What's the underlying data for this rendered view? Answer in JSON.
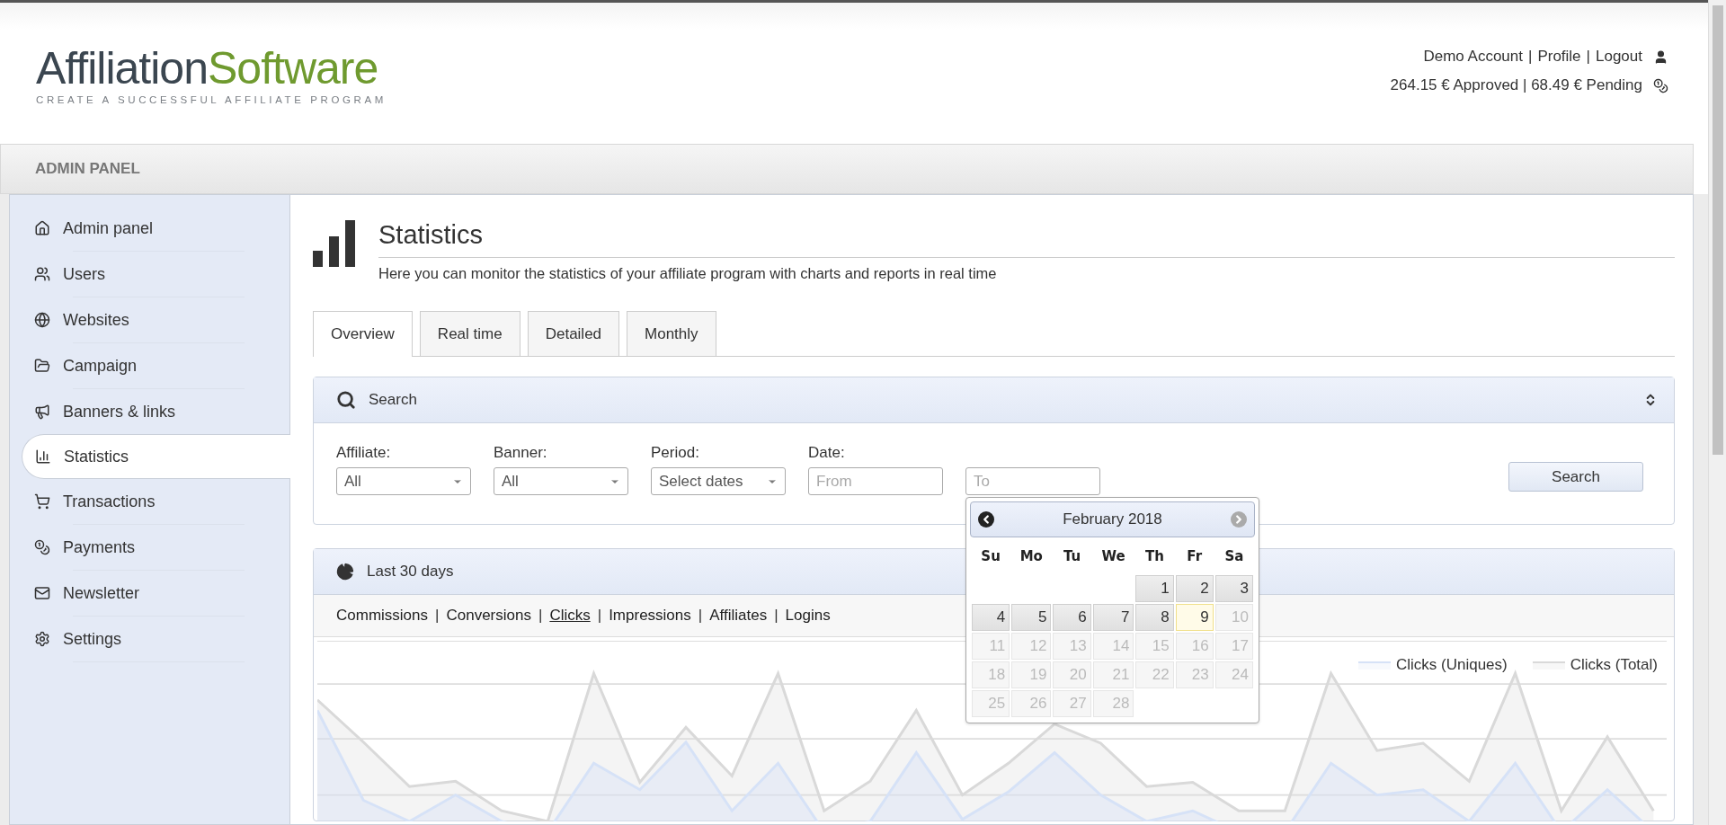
{
  "logo": {
    "word_1": "Affiliation",
    "word_2": "Software",
    "tagline": "CREATE A SUCCESSFUL AFFILIATE PROGRAM"
  },
  "account": {
    "links": [
      "Demo Account",
      "Profile",
      "Logout"
    ],
    "separator": "|",
    "balance": "264.15 € Approved | 68.49 € Pending"
  },
  "panel_bar": {
    "title": "ADMIN PANEL"
  },
  "sidebar": {
    "items": [
      {
        "label": "Admin panel",
        "selected": false
      },
      {
        "label": "Users",
        "selected": false
      },
      {
        "label": "Websites",
        "selected": false
      },
      {
        "label": "Campaign",
        "selected": false
      },
      {
        "label": "Banners & links",
        "selected": false
      },
      {
        "label": "Statistics",
        "selected": true
      },
      {
        "label": "Transactions",
        "selected": false
      },
      {
        "label": "Payments",
        "selected": false
      },
      {
        "label": "Newsletter",
        "selected": false
      },
      {
        "label": "Settings",
        "selected": false
      }
    ]
  },
  "page": {
    "title": "Statistics",
    "subtitle": "Here you can monitor the statistics of your affiliate program with charts and reports in real time"
  },
  "tabs": [
    {
      "label": "Overview",
      "selected": true
    },
    {
      "label": "Real time",
      "selected": false
    },
    {
      "label": "Detailed",
      "selected": false
    },
    {
      "label": "Monthly",
      "selected": false
    }
  ],
  "search_panel": {
    "title": "Search",
    "fields": [
      {
        "label": "Affiliate:",
        "kind": "select",
        "value": "All"
      },
      {
        "label": "Banner:",
        "kind": "select",
        "value": "All"
      },
      {
        "label": "Period:",
        "kind": "select",
        "value": "Select dates"
      },
      {
        "label": "Date:",
        "kind": "text",
        "placeholder": "From"
      },
      {
        "kind": "text",
        "placeholder": "To"
      }
    ],
    "button": "Search"
  },
  "calendar": {
    "month": "February 2018",
    "weekdays": [
      "Su",
      "Mo",
      "Tu",
      "We",
      "Th",
      "Fr",
      "Sa"
    ],
    "weeks": [
      {
        "kind": "first",
        "days": [
          {
            "day": "1",
            "disabled": false,
            "today": false
          },
          {
            "day": "2",
            "disabled": false,
            "today": false
          },
          {
            "day": "3",
            "disabled": false,
            "today": false
          }
        ]
      },
      {
        "kind": "full",
        "days": [
          {
            "day": "4",
            "disabled": false,
            "today": false
          },
          {
            "day": "5",
            "disabled": false,
            "today": false
          },
          {
            "day": "6",
            "disabled": false,
            "today": false
          },
          {
            "day": "7",
            "disabled": false,
            "today": false
          },
          {
            "day": "8",
            "disabled": false,
            "today": false
          },
          {
            "day": "9",
            "disabled": false,
            "today": true
          },
          {
            "day": "10",
            "disabled": true,
            "today": false
          }
        ]
      },
      {
        "kind": "full",
        "days": [
          {
            "day": "11",
            "disabled": true,
            "today": false
          },
          {
            "day": "12",
            "disabled": true,
            "today": false
          },
          {
            "day": "13",
            "disabled": true,
            "today": false
          },
          {
            "day": "14",
            "disabled": true,
            "today": false
          },
          {
            "day": "15",
            "disabled": true,
            "today": false
          },
          {
            "day": "16",
            "disabled": true,
            "today": false
          },
          {
            "day": "17",
            "disabled": true,
            "today": false
          }
        ]
      },
      {
        "kind": "full",
        "days": [
          {
            "day": "18",
            "disabled": true,
            "today": false
          },
          {
            "day": "19",
            "disabled": true,
            "today": false
          },
          {
            "day": "20",
            "disabled": true,
            "today": false
          },
          {
            "day": "21",
            "disabled": true,
            "today": false
          },
          {
            "day": "22",
            "disabled": true,
            "today": false
          },
          {
            "day": "23",
            "disabled": true,
            "today": false
          },
          {
            "day": "24",
            "disabled": true,
            "today": false
          }
        ]
      },
      {
        "kind": "last",
        "days": [
          {
            "day": "25",
            "disabled": true,
            "today": false
          },
          {
            "day": "26",
            "disabled": true,
            "today": false
          },
          {
            "day": "27",
            "disabled": true,
            "today": false
          },
          {
            "day": "28",
            "disabled": true,
            "today": false
          }
        ]
      }
    ]
  },
  "stats_panel": {
    "title": "Last 30 days",
    "separator": "|",
    "links": [
      {
        "label": "Commissions",
        "selected": false
      },
      {
        "label": "Conversions",
        "selected": false
      },
      {
        "label": "Clicks",
        "selected": true
      },
      {
        "label": "Impressions",
        "selected": false
      },
      {
        "label": "Affiliates",
        "selected": false
      },
      {
        "label": "Logins",
        "selected": false
      }
    ],
    "legend": [
      {
        "label": "Clicks (Uniques)",
        "color": "#d6e2f7"
      },
      {
        "label": "Clicks (Total)",
        "color": "#d9d9d9"
      }
    ]
  }
}
